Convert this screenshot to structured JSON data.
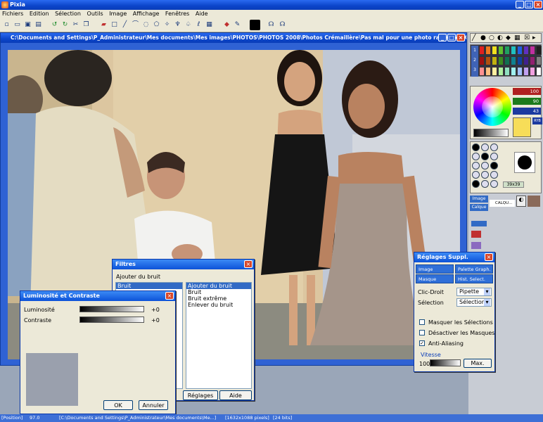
{
  "app": {
    "title": "Pixia"
  },
  "menu": [
    "Fichiers",
    "Edition",
    "Sélection",
    "Outils",
    "Image",
    "Affichage",
    "Fenêtres",
    "Aide"
  ],
  "document": {
    "title": "C:\\Documents and Settings\\P_Administrateur\\Mes documents\\Mes images\\PHOTOS\\PHOTOS 2008\\Photos Crémaillère\\Pas mal pour une photo ratée.jpg [CALQ..."
  },
  "filters": {
    "title": "Filtres",
    "category": "Ajouter du bruit",
    "left_list": [
      "Bruit"
    ],
    "right_list": [
      "Ajouter du bruit",
      "Bruit",
      "Bruit extrême",
      "Enlever du bruit"
    ],
    "settings_label": "Réglages",
    "help_label": "Aide"
  },
  "brightness": {
    "title": "Luminosité et Contraste",
    "luminosity_label": "Luminosité",
    "luminosity_value": "+0",
    "contrast_label": "Contraste",
    "contrast_value": "+0",
    "ok_label": "OK",
    "cancel_label": "Annuler"
  },
  "extra": {
    "title": "Réglages Suppl.",
    "tabs": [
      "Image",
      "Palette Graph.",
      "Masque",
      "Hist. Select."
    ],
    "right_click_label": "Clic-Droit",
    "right_click_value": "Pipette",
    "selection_label": "Sélection",
    "selection_value": "Sélection",
    "checkboxes": [
      {
        "label": "Masquer les Sélections",
        "checked": false
      },
      {
        "label": "Désactiver les Masques",
        "checked": false
      },
      {
        "label": "Anti-Aliasing",
        "checked": true
      }
    ],
    "speed_label": "Vitesse",
    "speed_value": "100",
    "max_label": "Max."
  },
  "right_panel": {
    "rgb": [
      "100",
      "90",
      "43"
    ],
    "ryb": "RYB",
    "brush_size": "39x39",
    "layers": [
      "Image",
      "Calque"
    ],
    "calque_name": "CALQU...",
    "rows": [
      "1",
      "2",
      "3"
    ]
  },
  "status": {
    "position_label": "[Position]",
    "position_value": "97.0",
    "path": "[C:\\Documents and Settings\\P_Administrateur\\Mes documents\\Me...]",
    "size": "[1632x1088 pixels]",
    "bits": "[24 bits]"
  },
  "colors": {
    "accent": "#0b45c9",
    "primary": "#000000",
    "secondary": "#f7dd58"
  }
}
